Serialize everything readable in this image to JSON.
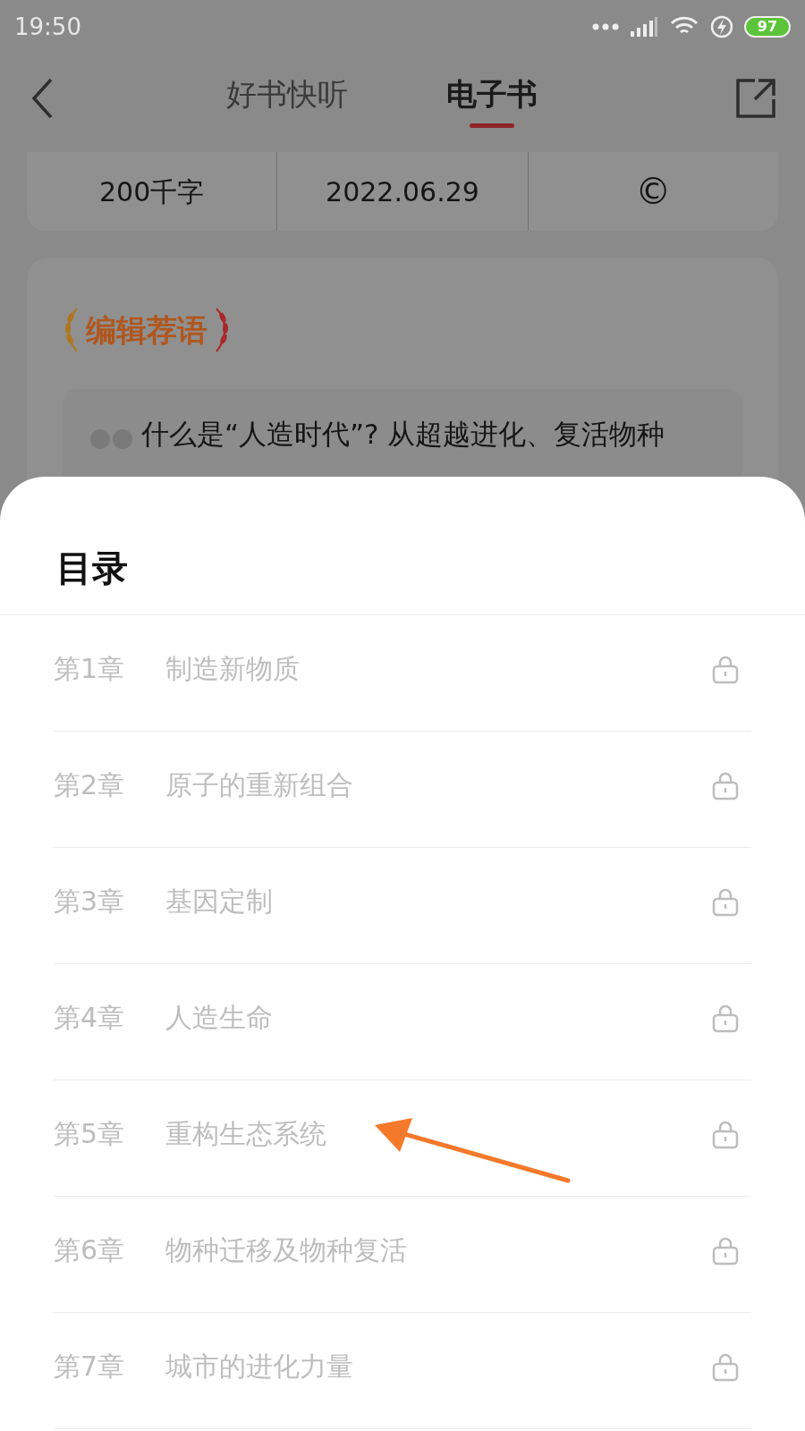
{
  "status_bar": {
    "time": "19:50",
    "battery": "97"
  },
  "nav": {
    "tabs": [
      {
        "label": "好书快听",
        "selected": false
      },
      {
        "label": "电子书",
        "selected": true
      }
    ]
  },
  "stats": [
    "200千字",
    "2022.06.29",
    "©"
  ],
  "recommendation": {
    "title": "编辑荐语",
    "quote": "什么是“人造时代”? 从超越进化、复活物种"
  },
  "sheet": {
    "title": "目录",
    "chapters": [
      {
        "number": "第1章",
        "title": "制造新物质",
        "locked": true
      },
      {
        "number": "第2章",
        "title": "原子的重新组合",
        "locked": true
      },
      {
        "number": "第3章",
        "title": "基因定制",
        "locked": true
      },
      {
        "number": "第4章",
        "title": "人造生命",
        "locked": true
      },
      {
        "number": "第5章",
        "title": "重构生态系统",
        "locked": true
      },
      {
        "number": "第6章",
        "title": "物种迁移及物种复活",
        "locked": true
      },
      {
        "number": "第7章",
        "title": "城市的进化力量",
        "locked": true
      }
    ]
  },
  "annotation": {
    "kind": "arrow"
  }
}
